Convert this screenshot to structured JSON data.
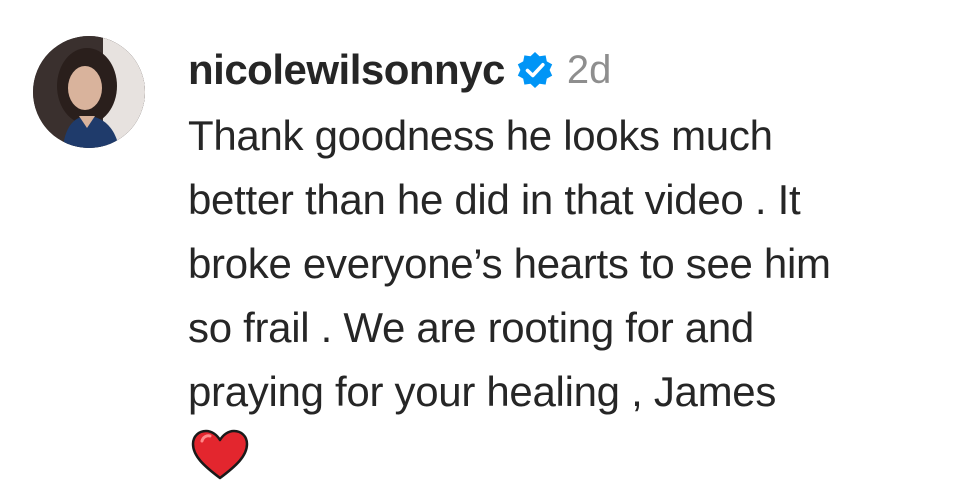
{
  "comment": {
    "username": "nicolewilsonnyc",
    "verified": true,
    "timestamp": "2d",
    "text": "Thank goodness he looks much\nbetter than he did in that video . It\nbroke everyone’s hearts to see him\nso frail . We are rooting for and\npraying for your healing , James",
    "emoji": "red-heart",
    "avatar_icon": "profile-photo",
    "colors": {
      "verified_badge": "#0095f6",
      "text": "#262626",
      "timestamp": "#8e8e8e",
      "heart": "#e3262e"
    }
  }
}
